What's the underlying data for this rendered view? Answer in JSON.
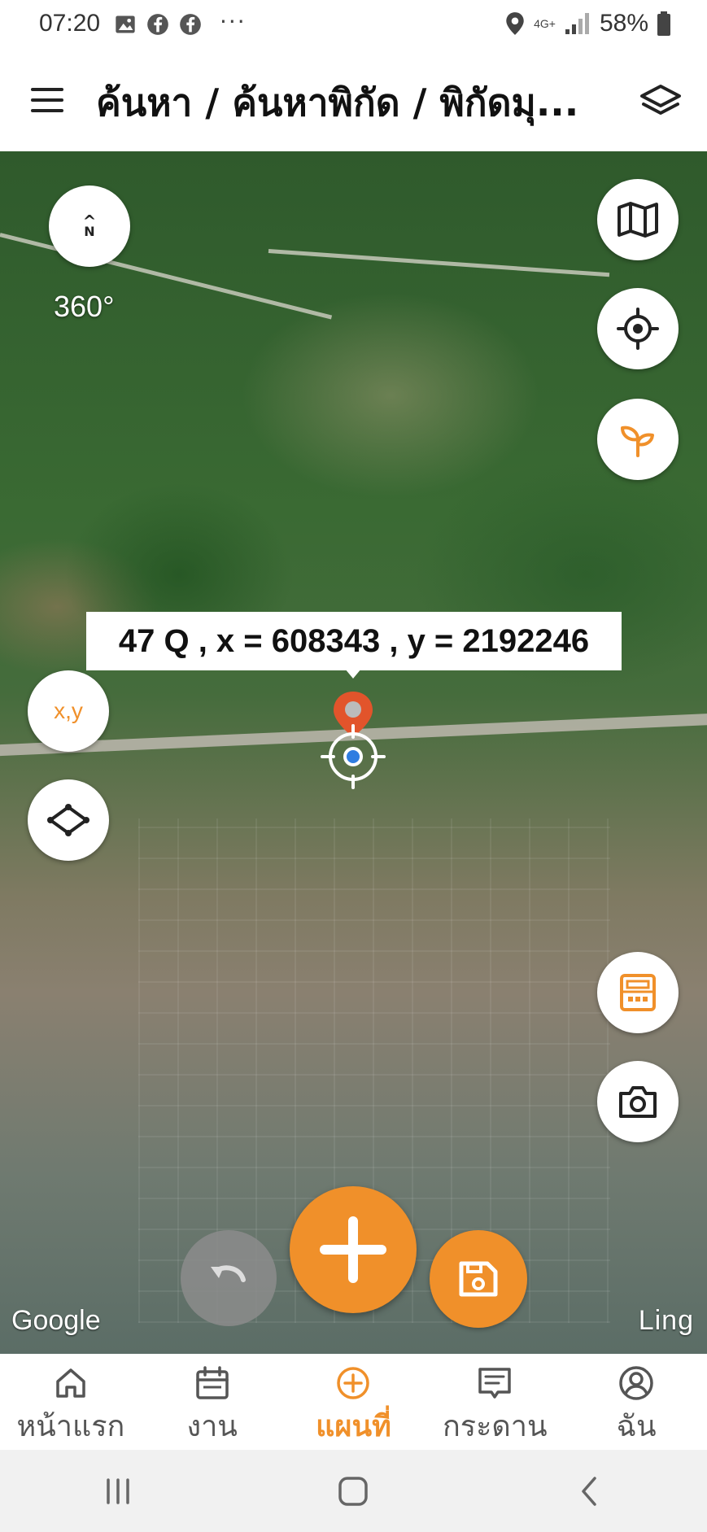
{
  "status_bar": {
    "time": "07:20",
    "icons": [
      "gallery-icon",
      "facebook-icon",
      "facebook-icon"
    ],
    "more": "···",
    "network": "4G+",
    "battery": "58%"
  },
  "header": {
    "title": "ค้นหา / ค้นหาพิกัด / พิกัดมุ...",
    "menu_icon": "menu-icon",
    "layers_icon": "layers-icon"
  },
  "map": {
    "compass_label": "N",
    "rotation_label": "360°",
    "xy_button_label": "x,y",
    "coordinate_label": "47 Q , x = 608343 , y = 2192246",
    "google_label": "Google",
    "place_label": "Ling",
    "accent_color": "#f0902a",
    "right_buttons": [
      "map-icon",
      "target-icon",
      "sprout-icon",
      "calculator-icon",
      "camera-icon"
    ]
  },
  "bottom_nav": {
    "items": [
      {
        "label": "หน้าแรก",
        "icon": "home-icon"
      },
      {
        "label": "งาน",
        "icon": "calendar-icon"
      },
      {
        "label": "แผนที่",
        "icon": "plus-circle-icon",
        "active": true
      },
      {
        "label": "กระดาน",
        "icon": "board-icon"
      },
      {
        "label": "ฉัน",
        "icon": "user-icon"
      }
    ]
  }
}
